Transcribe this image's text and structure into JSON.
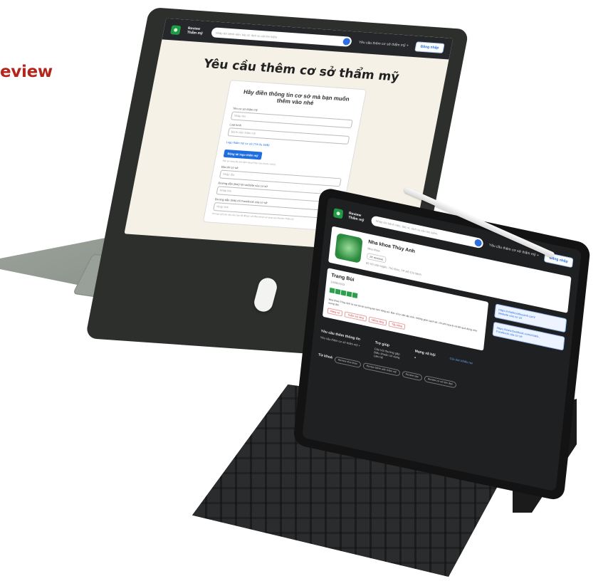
{
  "heading": "eview",
  "laptop": {
    "logo_text": "Review Thẩm mỹ",
    "search_placeholder": "Nhập tên bệnh viện, bác sĩ, dịch vụ cần tìm kiếm",
    "nav_link": "Yêu cầu thêm cơ sở thẩm mỹ +",
    "login_button": "Đăng nhập",
    "page_title": "Yêu cầu thêm cơ sở thẩm mỹ",
    "form_heading": "Hãy điền thông tin cơ sở mà bạn muốn thêm vào nhé",
    "fields": [
      {
        "label": "Tên cơ sở thẩm mỹ",
        "placeholder": "Nhập tên"
      },
      {
        "label": "Loại hình",
        "placeholder": "Bệnh viện thẩm mỹ"
      }
    ],
    "logo_note": "Logo thẩm mỹ cơ sở (Tối đa 1MB)",
    "upload_button": "Đăng tải logo thẩm mỹ",
    "upload_hint": "Nên sử dụng file ảnh định dạng PNG, kích thước vuông",
    "fields_2": [
      {
        "label": "Địa chỉ cơ sở",
        "placeholder": "Nhập địa"
      },
      {
        "label": "Đường dẫn (link) tới website của cơ sở",
        "placeholder": "Nhập link"
      },
      {
        "label": "Đường dẫn (link) tới Facebook của cơ sở",
        "placeholder": "Nhập link"
      }
    ],
    "consent_note": "Khi bạn gửi yêu cầu này, bạn đã đồng ý với điều khoản sử dụng của Review Thẩm mỹ"
  },
  "tablet": {
    "logo_text": "Review Thẩm mỹ",
    "search_placeholder": "Nhập tên bệnh viện, bác sĩ, dịch vụ cần tìm kiếm",
    "nav_link": "Yêu cầu thêm cơ sở thẩm mỹ +",
    "login_button": "Đăng nhập",
    "business_name": "Nha khoa Thùy Anh",
    "business_category": "Nha khoa",
    "business_rating_count": "24 reviews",
    "business_address": "85 Võ Văn Ngân, Thủ Đức, TP Hồ Chí Minh",
    "review_author": "Trang Bùi",
    "review_date": "15/08/2023",
    "review_text": "Nha khoa Thùy Anh là nơi tôi tin tưởng khi làm răng sứ. Bác sĩ tư vấn tận tình, không gian sạch sẽ, chi phí hợp lý và kết quả đúng như mong đợi.",
    "review_tags": [
      "Răng sứ",
      "Thẩm mỹ răng",
      "Niềng răng",
      "Tẩy trắng"
    ],
    "links": [
      {
        "label": "https://nhakhoathuyanh.com/",
        "sub": "Website của cơ sở"
      },
      {
        "label": "https://www.facebook.com/nhakh...",
        "sub": "Facebook của cơ sở"
      }
    ],
    "footer": {
      "col1_title": "Yêu cầu thêm thông tin",
      "col1_item": "Yêu cầu thêm cơ sở thẩm mỹ +",
      "col2_title": "Trợ giúp",
      "col2_items": [
        "Câu hỏi thường gặp",
        "Điều khoản sử dụng",
        "Liên hệ"
      ],
      "col3_title": "Mạng xã hội",
      "col4_link": "Gửi đơn khiếu nại"
    },
    "chips_label": "Từ khoá",
    "chips": [
      "Review nha khoa",
      "Review bệnh viện thẩm mỹ",
      "Review spa",
      "Review cơ sở làm đẹp"
    ]
  }
}
